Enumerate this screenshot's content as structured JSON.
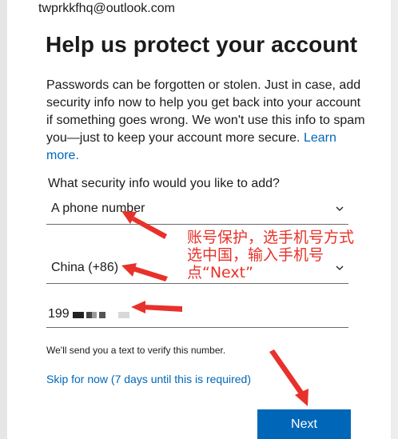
{
  "account": {
    "email": "twprkkfhq@outlook.com"
  },
  "header": {
    "title": "Help us protect your account"
  },
  "body": {
    "description": "Passwords can be forgotten or stolen. Just in case, add security info now to help you get back into your account if something goes wrong. We won't use this info to spam you—just to keep your account more secure.",
    "learn_more": "Learn more."
  },
  "form": {
    "question": "What security info would you like to add?",
    "method_value": "A phone number",
    "country_value": "China (+86)",
    "phone_value": "199",
    "note": "We'll send you a text to verify this number.",
    "skip_label": "Skip for now (7 days until this is required)",
    "next_label": "Next"
  },
  "annotation": {
    "lines": [
      "账号保护，选手机号方式",
      "选中国，输入手机号",
      "点“Next”"
    ]
  },
  "colors": {
    "accent": "#0067b8",
    "annotation": "#e8312a",
    "text": "#1b1b1b"
  },
  "icons": {
    "dropdown": "chevron-down-icon"
  }
}
